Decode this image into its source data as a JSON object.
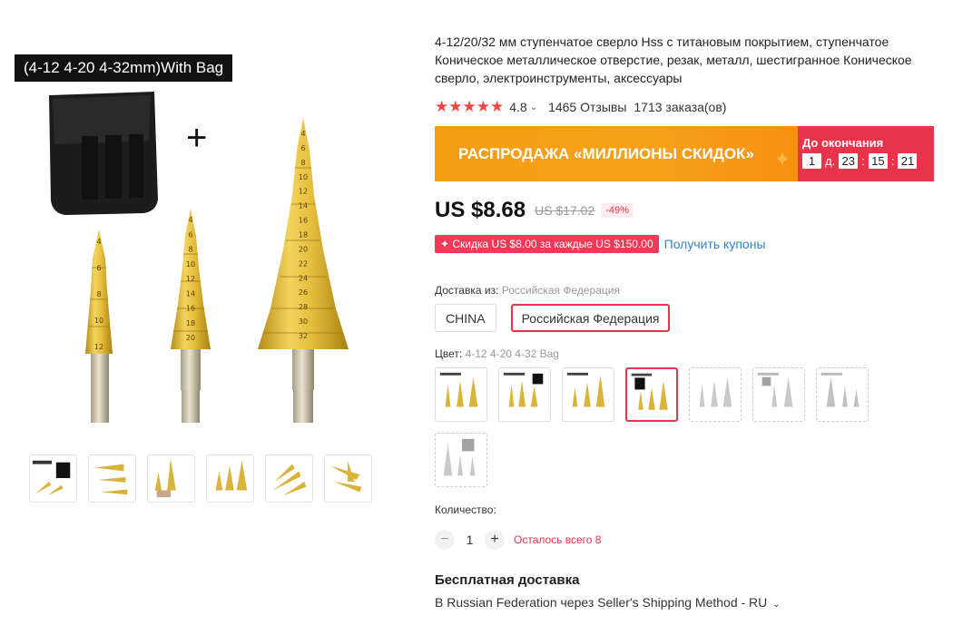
{
  "gallery": {
    "variant_caption": "(4-12 4-20 4-32mm)With Bag",
    "plus_sign": "+",
    "drill_marks": {
      "small": [
        "4",
        "6",
        "8",
        "10",
        "12"
      ],
      "medium": [
        "4",
        "6",
        "8",
        "10",
        "12",
        "14",
        "16",
        "18",
        "20"
      ],
      "large": [
        "4",
        "6",
        "8",
        "10",
        "12",
        "14",
        "16",
        "18",
        "20",
        "22",
        "24",
        "26",
        "28",
        "30",
        "32"
      ]
    },
    "thumbnail_count": 6
  },
  "product": {
    "title": "4-12/20/32 мм ступенчатое сверло Hss с титановым покрытием, ступенчатое Коническое металлическое отверстие, резак, металл, шестигранное Коническое сверло, электроинструменты, аксессуары",
    "stars": "★★★★★",
    "rating": "4.8",
    "reviews": "1465 Отзывы",
    "orders": "1713 заказа(ов)"
  },
  "sale": {
    "title": "РАСПРОДАЖА «МИЛЛИОНЫ СКИДОК»",
    "countdown_label": "До окончания",
    "days": "1",
    "days_unit": "д.",
    "hours": "23",
    "minutes": "15",
    "seconds": "21"
  },
  "price": {
    "current": "US $8.68",
    "original": "US $17.02",
    "discount": "-49%"
  },
  "coupon": {
    "badge": "✦ Скидка US $8.00 за каждые US $150.00",
    "link": "Получить купоны"
  },
  "shipping_from": {
    "label": "Доставка из:",
    "selected": "Российская Федерация",
    "options": [
      "CHINA",
      "Российская Федерация"
    ]
  },
  "color": {
    "label": "Цвет:",
    "selected": "4-12 4-20 4-32 Bag",
    "swatch_count": 8
  },
  "quantity": {
    "label": "Количество:",
    "minus": "−",
    "value": "1",
    "plus": "+",
    "stock": "Осталось всего 8"
  },
  "delivery": {
    "free_label": "Бесплатная доставка",
    "method": "В Russian Federation через Seller's Shipping Method - RU"
  },
  "colors": {
    "accent_red": "#e8344a",
    "sale_orange": "#f7a11b",
    "link_blue": "#3384c7",
    "gold": "#d9b33a"
  }
}
